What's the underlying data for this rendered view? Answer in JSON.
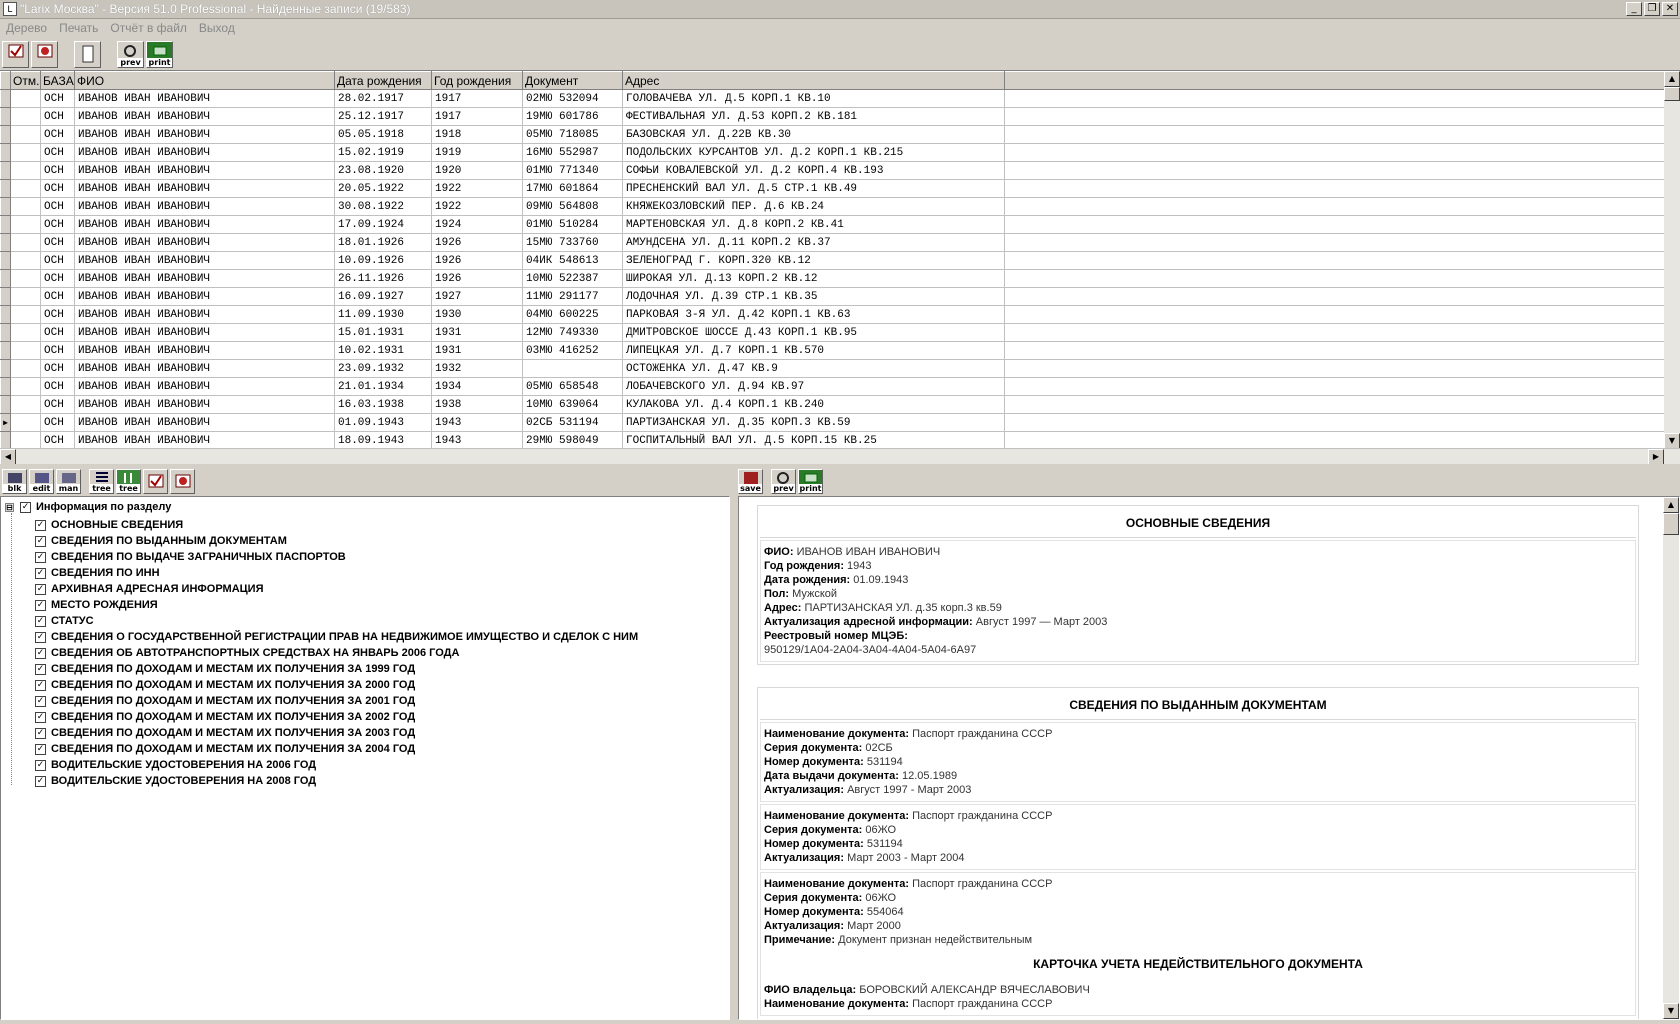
{
  "window": {
    "title": "\"Larix Москва\" - Версия 51.0 Professional - Найденные записи (19/583)",
    "minimize": "_",
    "restore": "❐",
    "close": "✕"
  },
  "menu": [
    "Дерево",
    "Печать",
    "Отчёт в файл",
    "Выход"
  ],
  "toolbar": {
    "items": [
      {
        "icon": "check-card-icon",
        "label": ""
      },
      {
        "icon": "cancel-card-icon",
        "label": ""
      },
      {
        "icon": "document-icon",
        "label": ""
      },
      {
        "icon": "preview-icon",
        "label": "prev"
      },
      {
        "icon": "print-icon",
        "label": "print"
      }
    ]
  },
  "grid": {
    "columns": [
      "Отм.",
      "БАЗА",
      "ФИО",
      "Дата рождения",
      "Год рождения",
      "Документ",
      "Адрес"
    ],
    "current_row_indicator": "▶",
    "rows": [
      [
        "",
        "ОСН",
        "ИВАНОВ ИВАН ИВАНОВИЧ",
        "28.02.1917",
        "1917",
        "02МЮ 532094",
        "ГОЛОВАЧЕВА УЛ. Д.5 КОРП.1 КВ.10"
      ],
      [
        "",
        "ОСН",
        "ИВАНОВ ИВАН ИВАНОВИЧ",
        "25.12.1917",
        "1917",
        "19МЮ 601786",
        "ФЕСТИВАЛЬНАЯ УЛ. Д.53 КОРП.2 КВ.181"
      ],
      [
        "",
        "ОСН",
        "ИВАНОВ ИВАН ИВАНОВИЧ",
        "05.05.1918",
        "1918",
        "05МЮ 718085",
        "БАЗОВСКАЯ УЛ. Д.22В КВ.30"
      ],
      [
        "",
        "ОСН",
        "ИВАНОВ ИВАН ИВАНОВИЧ",
        "15.02.1919",
        "1919",
        "16МЮ 552987",
        "ПОДОЛЬСКИХ КУРСАНТОВ УЛ. Д.2 КОРП.1 КВ.215"
      ],
      [
        "",
        "ОСН",
        "ИВАНОВ ИВАН ИВАНОВИЧ",
        "23.08.1920",
        "1920",
        "01МЮ 771340",
        "СОФЬИ КОВАЛЕВСКОЙ УЛ. Д.2 КОРП.4 КВ.193"
      ],
      [
        "",
        "ОСН",
        "ИВАНОВ ИВАН ИВАНОВИЧ",
        "20.05.1922",
        "1922",
        "17МЮ 601864",
        "ПРЕСНЕНСКИЙ ВАЛ УЛ. Д.5 СТР.1 КВ.49"
      ],
      [
        "",
        "ОСН",
        "ИВАНОВ ИВАН ИВАНОВИЧ",
        "30.08.1922",
        "1922",
        "09МЮ 564808",
        "КНЯЖЕКОЗЛОВСКИЙ ПЕР. Д.6 КВ.24"
      ],
      [
        "",
        "ОСН",
        "ИВАНОВ ИВАН ИВАНОВИЧ",
        "17.09.1924",
        "1924",
        "01МЮ 510284",
        "МАРТЕНОВСКАЯ УЛ. Д.8 КОРП.2 КВ.41"
      ],
      [
        "",
        "ОСН",
        "ИВАНОВ ИВАН ИВАНОВИЧ",
        "18.01.1926",
        "1926",
        "15МЮ 733760",
        "АМУНДСЕНА УЛ. Д.11 КОРП.2 КВ.37"
      ],
      [
        "",
        "ОСН",
        "ИВАНОВ ИВАН ИВАНОВИЧ",
        "10.09.1926",
        "1926",
        "04ИК 548613",
        "ЗЕЛЕНОГРАД Г. КОРП.320 КВ.12"
      ],
      [
        "",
        "ОСН",
        "ИВАНОВ ИВАН ИВАНОВИЧ",
        "26.11.1926",
        "1926",
        "10МЮ 522387",
        "ШИРОКАЯ УЛ. Д.13 КОРП.2 КВ.12"
      ],
      [
        "",
        "ОСН",
        "ИВАНОВ ИВАН ИВАНОВИЧ",
        "16.09.1927",
        "1927",
        "11МЮ 291177",
        "ЛОДОЧНАЯ УЛ. Д.39 СТР.1 КВ.35"
      ],
      [
        "",
        "ОСН",
        "ИВАНОВ ИВАН ИВАНОВИЧ",
        "11.09.1930",
        "1930",
        "04МЮ 600225",
        "ПАРКОВАЯ 3-Я УЛ. Д.42 КОРП.1 КВ.63"
      ],
      [
        "",
        "ОСН",
        "ИВАНОВ ИВАН ИВАНОВИЧ",
        "15.01.1931",
        "1931",
        "12МЮ 749330",
        "ДМИТРОВСКОЕ ШОССЕ Д.43 КОРП.1 КВ.95"
      ],
      [
        "",
        "ОСН",
        "ИВАНОВ ИВАН ИВАНОВИЧ",
        "10.02.1931",
        "1931",
        "03МЮ 416252",
        "ЛИПЕЦКАЯ УЛ. Д.7 КОРП.1 КВ.570"
      ],
      [
        "",
        "ОСН",
        "ИВАНОВ ИВАН ИВАНОВИЧ",
        "23.09.1932",
        "1932",
        "",
        "ОСТОЖЕНКА УЛ. Д.47 КВ.9"
      ],
      [
        "",
        "ОСН",
        "ИВАНОВ ИВАН ИВАНОВИЧ",
        "21.01.1934",
        "1934",
        "05МЮ 658548",
        "ЛОБАЧЕВСКОГО УЛ. Д.94 КВ.97"
      ],
      [
        "",
        "ОСН",
        "ИВАНОВ ИВАН ИВАНОВИЧ",
        "16.03.1938",
        "1938",
        "10МЮ 639064",
        "КУЛАКОВА УЛ. Д.4 КОРП.1 КВ.240"
      ],
      [
        "",
        "ОСН",
        "ИВАНОВ ИВАН ИВАНОВИЧ",
        "01.09.1943",
        "1943",
        "02СБ 531194",
        "ПАРТИЗАНСКАЯ УЛ. Д.35 КОРП.3 КВ.59"
      ],
      [
        "",
        "ОСН",
        "ИВАНОВ ИВАН ИВАНОВИЧ",
        "18.09.1943",
        "1943",
        "29МЮ 598049",
        "ГОСПИТАЛЬНЫЙ ВАЛ УЛ. Д.5 КОРП.15 КВ.25"
      ]
    ],
    "current_row": 18
  },
  "left_toolbar": [
    {
      "icon": "blk-icon",
      "label": "blk"
    },
    {
      "icon": "edit-icon",
      "label": "edit"
    },
    {
      "icon": "man-icon",
      "label": "man"
    },
    {
      "icon": "tree-icon",
      "label": "tree"
    },
    {
      "icon": "tree-icon",
      "label": "tree"
    },
    {
      "icon": "check-card-icon",
      "label": ""
    },
    {
      "icon": "cancel-card-icon",
      "label": ""
    }
  ],
  "right_toolbar": [
    {
      "icon": "save-icon",
      "label": "save"
    },
    {
      "icon": "preview-icon",
      "label": "prev"
    },
    {
      "icon": "print-icon",
      "label": "print"
    }
  ],
  "tree": {
    "expander": "⊟",
    "check": "✓",
    "root": "Информация по разделу",
    "items": [
      "ОСНОВНЫЕ СВЕДЕНИЯ",
      "СВЕДЕНИЯ ПО ВЫДАННЫМ ДОКУМЕНТАМ",
      "СВЕДЕНИЯ ПО ВЫДАЧЕ ЗАГРАНИЧНЫХ ПАСПОРТОВ",
      "СВЕДЕНИЯ ПО ИНН",
      "АРХИВНАЯ АДРЕСНАЯ ИНФОРМАЦИЯ",
      "МЕСТО РОЖДЕНИЯ",
      "СТАТУС",
      "СВЕДЕНИЯ О ГОСУДАРСТВЕННОЙ РЕГИСТРАЦИИ ПРАВ НА НЕДВИЖИМОЕ ИМУЩЕСТВО И СДЕЛОК С НИМ",
      "СВЕДЕНИЯ ОБ АВТОТРАНСПОРТНЫХ СРЕДСТВАХ НА ЯНВАРЬ 2006 ГОДА",
      "СВЕДЕНИЯ ПО ДОХОДАМ И МЕСТАМ ИХ ПОЛУЧЕНИЯ ЗА 1999 ГОД",
      "СВЕДЕНИЯ ПО ДОХОДАМ И МЕСТАМ ИХ ПОЛУЧЕНИЯ ЗА 2000 ГОД",
      "СВЕДЕНИЯ ПО ДОХОДАМ И МЕСТАМ ИХ ПОЛУЧЕНИЯ ЗА 2001 ГОД",
      "СВЕДЕНИЯ ПО ДОХОДАМ И МЕСТАМ ИХ ПОЛУЧЕНИЯ ЗА 2002 ГОД",
      "СВЕДЕНИЯ ПО ДОХОДАМ И МЕСТАМ ИХ ПОЛУЧЕНИЯ ЗА 2003 ГОД",
      "СВЕДЕНИЯ ПО ДОХОДАМ И МЕСТАМ ИХ ПОЛУЧЕНИЯ ЗА 2004 ГОД",
      "ВОДИТЕЛЬСКИЕ УДОСТОВЕРЕНИЯ НА 2006 ГОД",
      "ВОДИТЕЛЬСКИЕ УДОСТОВЕРЕНИЯ НА 2008 ГОД"
    ]
  },
  "detail": {
    "basic": {
      "title": "ОСНОВНЫЕ СВЕДЕНИЯ",
      "lines": [
        {
          "k": "ФИО:",
          "v": "ИВАНОВ ИВАН ИВАНОВИЧ"
        },
        {
          "k": "Год рождения:",
          "v": "1943"
        },
        {
          "k": "Дата рождения:",
          "v": "01.09.1943"
        },
        {
          "k": "Пол:",
          "v": "Мужской"
        },
        {
          "k": "Адрес:",
          "v": "ПАРТИЗАНСКАЯ УЛ. д.35 корп.3 кв.59"
        },
        {
          "k": "Актуализация адресной информации:",
          "v": "Август 1997 — Март 2003"
        },
        {
          "k": "Реестровый номер МЦЭБ:",
          "v": ""
        },
        {
          "k": "",
          "v": "950129/1А04-2А04-3А04-4А04-5А04-6А97"
        }
      ]
    },
    "docs": {
      "title": "СВЕДЕНИЯ ПО ВЫДАННЫМ ДОКУМЕНТАМ",
      "blocks": [
        [
          {
            "k": "Наименование документа:",
            "v": "Паспорт гражданина СССР"
          },
          {
            "k": "Серия документа:",
            "v": "02СБ"
          },
          {
            "k": "Номер документа:",
            "v": "531194"
          },
          {
            "k": "Дата выдачи документа:",
            "v": "12.05.1989"
          },
          {
            "k": "Актуализация:",
            "v": "Август 1997 - Март 2003"
          }
        ],
        [
          {
            "k": "Наименование документа:",
            "v": "Паспорт гражданина СССР"
          },
          {
            "k": "Серия документа:",
            "v": "06ЖО"
          },
          {
            "k": "Номер документа:",
            "v": "531194"
          },
          {
            "k": "Актуализация:",
            "v": "Март 2003 - Март 2004"
          }
        ],
        [
          {
            "k": "Наименование документа:",
            "v": "Паспорт гражданина СССР"
          },
          {
            "k": "Серия документа:",
            "v": "06ЖО"
          },
          {
            "k": "Номер документа:",
            "v": "554064"
          },
          {
            "k": "Актуализация:",
            "v": "Март 2000"
          },
          {
            "k": "Примечание:",
            "v": "Документ признан недействительным"
          }
        ]
      ],
      "card_title": "КАРТОЧКА УЧЕТА НЕДЕЙСТВИТЕЛЬНОГО ДОКУМЕНТА",
      "card_lines": [
        {
          "k": "ФИО владельца:",
          "v": "БОРОВСКИЙ АЛЕКСАНДР ВЯЧЕСЛАВОВИЧ"
        },
        {
          "k": "Наименование документа:",
          "v": "Паспорт гражданина СССР"
        }
      ]
    }
  },
  "scroll": {
    "up": "▲",
    "down": "▼",
    "left": "◀",
    "right": "▶"
  }
}
